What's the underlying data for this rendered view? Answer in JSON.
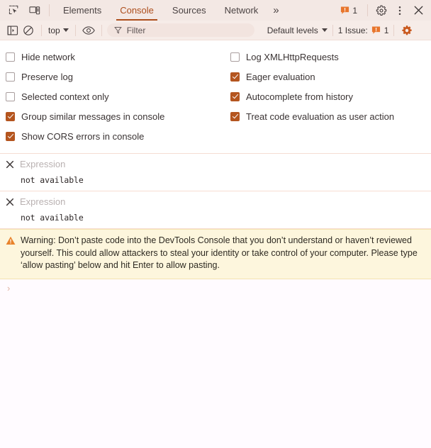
{
  "tabbar": {
    "icons": [
      {
        "name": "inspect-element-icon",
        "glyph": "inspect"
      },
      {
        "name": "device-toolbar-icon",
        "glyph": "device"
      }
    ],
    "tabs": [
      {
        "label": "Elements",
        "active": false
      },
      {
        "label": "Console",
        "active": true
      },
      {
        "label": "Sources",
        "active": false
      },
      {
        "label": "Network",
        "active": false
      }
    ],
    "more_label": "»",
    "issue_count": "1",
    "settings_icon": "gear-icon",
    "more_options_icon": "kebab-menu-icon",
    "close_icon": "close-icon"
  },
  "console_toolbar": {
    "sidebar_toggle_icon": "show-console-sidebar-icon",
    "clear_icon": "clear-console-icon",
    "context_label": "top",
    "live_expression_icon": "create-live-expression-icon",
    "filter_placeholder": "Filter",
    "filter_value": "",
    "filter_icon": "filter-icon",
    "levels_label": "Default levels",
    "issues_label": "1 Issue:",
    "issues_count": "1",
    "settings_icon": "console-settings-gear-icon"
  },
  "settings": {
    "left": [
      {
        "label": "Hide network",
        "checked": false
      },
      {
        "label": "Preserve log",
        "checked": false
      },
      {
        "label": "Selected context only",
        "checked": false
      },
      {
        "label": "Group similar messages in console",
        "checked": true
      },
      {
        "label": "Show CORS errors in console",
        "checked": true
      }
    ],
    "right": [
      {
        "label": "Log XMLHttpRequests",
        "checked": false
      },
      {
        "label": "Eager evaluation",
        "checked": true
      },
      {
        "label": "Autocomplete from history",
        "checked": true
      },
      {
        "label": "Treat code evaluation as user action",
        "checked": true
      }
    ]
  },
  "live_expressions": [
    {
      "placeholder": "Expression",
      "value": "not available",
      "remove_icon": "close-x-icon"
    },
    {
      "placeholder": "Expression",
      "value": "not available",
      "remove_icon": "close-x-icon"
    }
  ],
  "warning": {
    "icon": "warning-triangle-icon",
    "text": "Warning: Don’t paste code into the DevTools Console that you don’t understand or haven’t reviewed yourself. This could allow attackers to steal your identity or take control of your computer. Please type ‘allow pasting’ below and hit Enter to allow pasting."
  },
  "prompt": {
    "caret": "›",
    "value": ""
  },
  "colors": {
    "accent": "#ad4e1c",
    "checkbox_checked": "#b4551f",
    "warning_bg": "#fdf6dd",
    "warning_icon": "#e8822a",
    "toolbar_bg": "#f3e8e4",
    "console_toolbar_bg": "#f6ece8",
    "body_bg": "#fffbff",
    "issue_badge": "#e8762d"
  }
}
